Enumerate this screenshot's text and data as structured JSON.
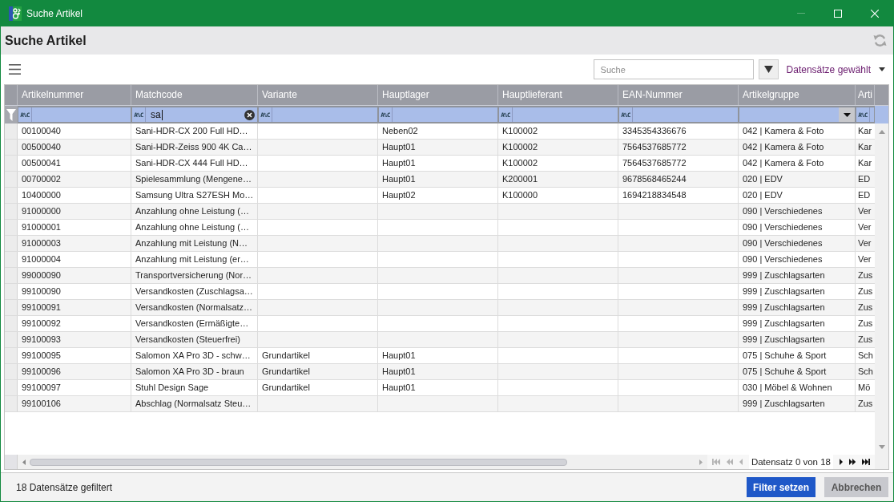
{
  "window": {
    "title": "Suche Artikel",
    "controls": [
      {
        "kind": "minimize",
        "disabled": true
      },
      {
        "kind": "maximize",
        "disabled": false
      },
      {
        "kind": "close",
        "disabled": false
      }
    ]
  },
  "header": {
    "title": "Suche Artikel"
  },
  "toolbar": {
    "search": {
      "placeholder": "Suche"
    },
    "selection_menu": {
      "label": "Datensätze gewählt"
    }
  },
  "table": {
    "columns": [
      {
        "label": "Artikelnummer",
        "filter": {
          "kind": "text",
          "operator": "A%C",
          "focused": false
        }
      },
      {
        "label": "Matchcode",
        "filter": {
          "kind": "text",
          "operator": "A%C",
          "value": "sa",
          "focused": true
        }
      },
      {
        "label": "Variante",
        "filter": {
          "kind": "text",
          "operator": "A%C",
          "focused": false
        }
      },
      {
        "label": "Hauptlager",
        "filter": {
          "kind": "text",
          "operator": "A%C",
          "focused": false
        }
      },
      {
        "label": "Hauptlieferant",
        "filter": {
          "kind": "text",
          "operator": "A%C",
          "focused": false
        }
      },
      {
        "label": "EAN-Nummer",
        "filter": {
          "kind": "text",
          "operator": "A%C",
          "focused": false
        }
      },
      {
        "label": "Artikelgruppe",
        "filter": {
          "kind": "dropdown"
        }
      },
      {
        "label": "Arti",
        "filter": {
          "kind": "text",
          "operator": "A%C",
          "focused": false
        }
      }
    ],
    "rows": [
      {
        "artikelnummer": "00100040",
        "matchcode": "Sani-HDR-CX 200 Full HD…",
        "hauptlager": "Neben02",
        "hauptlieferant": "K100002",
        "ean_nummer": "3345354336676",
        "artikelgruppe": "042 | Kamera & Foto",
        "column_8": "Kar"
      },
      {
        "artikelnummer": "00500040",
        "matchcode": "Sani-HDR-Zeiss 900 4K Ca…",
        "hauptlager": "Haupt01",
        "hauptlieferant": "K100002",
        "ean_nummer": "7564537685772",
        "artikelgruppe": "042 | Kamera & Foto",
        "column_8": "Kar"
      },
      {
        "artikelnummer": "00500041",
        "matchcode": "Sani-HDR-CX 444 Full HD…",
        "hauptlager": "Haupt01",
        "hauptlieferant": "K100002",
        "ean_nummer": "7564537685772",
        "artikelgruppe": "042 | Kamera & Foto",
        "column_8": "Kar"
      },
      {
        "artikelnummer": "00700002",
        "matchcode": "Spielesammlung (Mengene…",
        "hauptlager": "Haupt01",
        "hauptlieferant": "K200001",
        "ean_nummer": "9678568465244",
        "artikelgruppe": "020 | EDV",
        "column_8": "ED"
      },
      {
        "artikelnummer": "10400000",
        "matchcode": "Samsung Ultra S27ESH Mo…",
        "hauptlager": "Haupt02",
        "hauptlieferant": "K100000",
        "ean_nummer": "1694218834548",
        "artikelgruppe": "020 | EDV",
        "column_8": "ED"
      },
      {
        "artikelnummer": "91000000",
        "matchcode": "Anzahlung ohne Leistung (…",
        "artikelgruppe": "090 | Verschiedenes",
        "column_8": "Ver"
      },
      {
        "artikelnummer": "91000001",
        "matchcode": "Anzahlung ohne Leistung (…",
        "artikelgruppe": "090 | Verschiedenes",
        "column_8": "Ver"
      },
      {
        "artikelnummer": "91000003",
        "matchcode": "Anzahlung mit Leistung (N…",
        "artikelgruppe": "090 | Verschiedenes",
        "column_8": "Ver"
      },
      {
        "artikelnummer": "91000004",
        "matchcode": "Anzahlung mit Leistung (er…",
        "artikelgruppe": "090 | Verschiedenes",
        "column_8": "Ver"
      },
      {
        "artikelnummer": "99000090",
        "matchcode": "Transportversicherung (Nor…",
        "artikelgruppe": "999 | Zuschlagsarten",
        "column_8": "Zus"
      },
      {
        "artikelnummer": "99100090",
        "matchcode": "Versandkosten (Zuschlagsa…",
        "artikelgruppe": "999 | Zuschlagsarten",
        "column_8": "Zus"
      },
      {
        "artikelnummer": "99100091",
        "matchcode": "Versandkosten (Normalsatz…",
        "artikelgruppe": "999 | Zuschlagsarten",
        "column_8": "Zus"
      },
      {
        "artikelnummer": "99100092",
        "matchcode": "Versandkosten (Ermäßigte…",
        "artikelgruppe": "999 | Zuschlagsarten",
        "column_8": "Zus"
      },
      {
        "artikelnummer": "99100093",
        "matchcode": "Versandkosten (Steuerfrei)",
        "artikelgruppe": "999 | Zuschlagsarten",
        "column_8": "Zus"
      },
      {
        "artikelnummer": "99100095",
        "matchcode": "Salomon XA Pro 3D - schw…",
        "variante": "Grundartikel",
        "hauptlager": "Haupt01",
        "artikelgruppe": "075 | Schuhe & Sport",
        "column_8": "Sch"
      },
      {
        "artikelnummer": "99100096",
        "matchcode": "Salomon XA Pro 3D - braun",
        "variante": "Grundartikel",
        "hauptlager": "Haupt01",
        "artikelgruppe": "075 | Schuhe & Sport",
        "column_8": "Sch"
      },
      {
        "artikelnummer": "99100097",
        "matchcode": "Stuhl Design Sage",
        "variante": "Grundartikel",
        "hauptlager": "Haupt01",
        "artikelgruppe": "030 | Möbel & Wohnen",
        "column_8": "Mö"
      },
      {
        "artikelnummer": "99100106",
        "matchcode": "Abschlag (Normalsatz Steu…",
        "artikelgruppe": "999 | Zuschlagsarten",
        "column_8": "Zus"
      }
    ]
  },
  "navigator": {
    "position": "Datensatz 0 von 18",
    "buttons": [
      {
        "kind": "first",
        "disabled": true
      },
      {
        "kind": "prev_page",
        "disabled": true
      },
      {
        "kind": "prev",
        "disabled": true
      },
      {
        "kind": "next",
        "disabled": false
      },
      {
        "kind": "next_page",
        "disabled": false
      },
      {
        "kind": "last",
        "disabled": false
      }
    ]
  },
  "status_bar": {
    "text": "18 Datensätze gefiltert"
  },
  "buttons": [
    {
      "label": "Filter setzen",
      "kind": "primary"
    },
    {
      "label": "Abbrechen",
      "kind": "secondary"
    }
  ]
}
